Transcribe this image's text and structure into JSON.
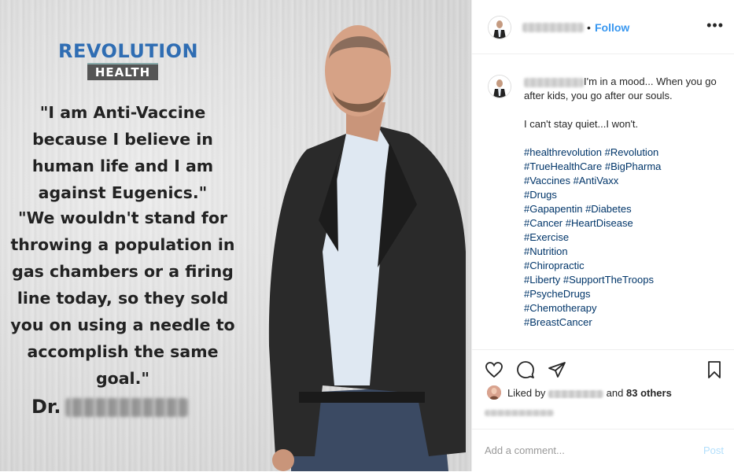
{
  "image": {
    "logo_top": "REVOLUTION",
    "logo_bottom": "HEALTH",
    "quote1": "\"I am Anti-Vaccine because I believe in human life and I am against Eugenics.\"",
    "quote2": "\"We wouldn't stand for throwing a population in gas chambers or a firing line today, so they sold you on using a needle to accomplish the same goal.\"",
    "doctor_prefix": "Dr."
  },
  "header": {
    "dot": "•",
    "follow_label": "Follow",
    "more_label": "•••"
  },
  "caption": {
    "intro": "I'm in a mood... When you go after kids, you go after our souls.",
    "line2": "I can't stay quiet...I won't.",
    "hashtag_lines": [
      "#healthrevolution #Revolution",
      "#TrueHealthCare #BigPharma",
      "#Vaccines #AntiVaxx",
      "#Drugs",
      "#Gapapentin #Diabetes",
      "#Cancer #HeartDisease",
      "#Exercise",
      "#Nutrition",
      "#Chiropractic",
      "#Liberty #SupportTheTroops",
      "#PsycheDrugs",
      "#Chemotherapy",
      "#BreastCancer"
    ]
  },
  "likes": {
    "prefix": "Liked by",
    "middle": "and",
    "others": "83 others"
  },
  "comment": {
    "placeholder": "Add a comment...",
    "post_label": "Post"
  },
  "icons": {
    "like": "heart-icon",
    "comment": "comment-icon",
    "share": "share-icon",
    "save": "bookmark-icon",
    "more": "more-options-icon"
  },
  "colors": {
    "link": "#3897f0",
    "hashtag": "#003569",
    "post_disabled": "#b2dffc",
    "logo_blue": "#2f6db3"
  }
}
